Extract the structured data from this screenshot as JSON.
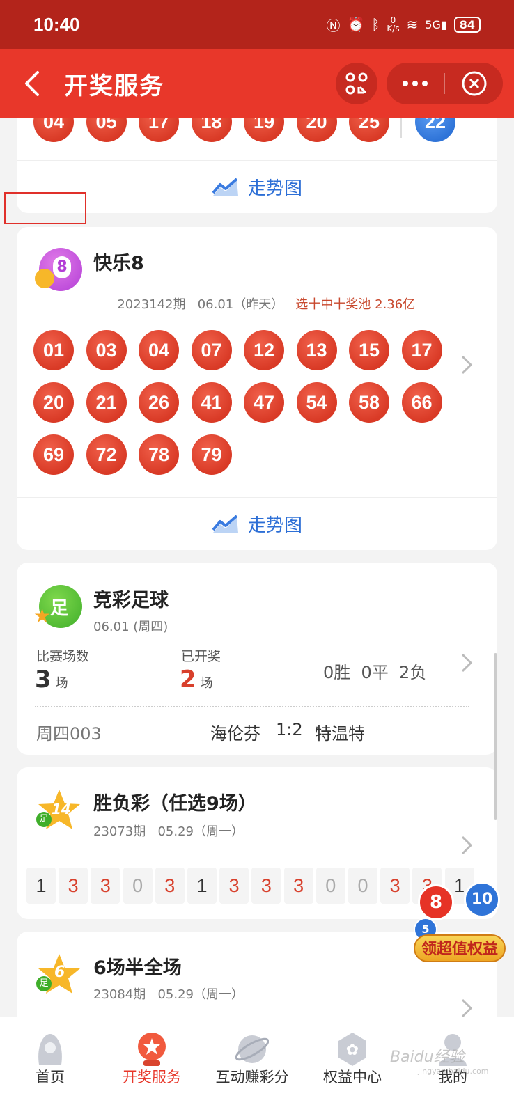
{
  "status_bar": {
    "time": "10:40",
    "net_speed": "0\nK/s",
    "battery": "84"
  },
  "header": {
    "title": "开奖服务"
  },
  "previous_card": {
    "balls": [
      "04",
      "05",
      "17",
      "18",
      "19",
      "20",
      "25"
    ],
    "blue_ball": "22",
    "trend_label": "走势图"
  },
  "kl8": {
    "name": "快乐8",
    "icon_text": "8",
    "issue": "2023142期",
    "date": "06.01（昨天）",
    "pool": "选十中十奖池 2.36亿",
    "balls": [
      "01",
      "03",
      "04",
      "07",
      "12",
      "13",
      "15",
      "17",
      "20",
      "21",
      "26",
      "41",
      "47",
      "54",
      "58",
      "66",
      "69",
      "72",
      "78",
      "79"
    ],
    "trend_label": "走势图"
  },
  "football": {
    "name": "竞彩足球",
    "icon_text": "足",
    "date": "06.01 (周四)",
    "matches_label": "比赛场数",
    "matches_value": "3",
    "matches_unit": "场",
    "drawn_label": "已开奖",
    "drawn_value": "2",
    "drawn_unit": "场",
    "summary": "0胜  0平  2负",
    "match": {
      "id": "周四003",
      "home": "海伦芬",
      "score": "1:2",
      "away": "特温特"
    }
  },
  "sfc": {
    "name": "胜负彩（任选9场）",
    "icon_text": "14",
    "icon_sub": "足",
    "issue": "23073期",
    "date": "05.29（周一）",
    "results": [
      "1",
      "3",
      "3",
      "0",
      "3",
      "1",
      "3",
      "3",
      "3",
      "0",
      "0",
      "3",
      "3",
      "1"
    ]
  },
  "half": {
    "name": "6场半全场",
    "icon_text": "6",
    "icon_sub": "足",
    "issue": "23084期",
    "date": "05.29（周一）"
  },
  "promo": {
    "label": "领超值权益",
    "ball_a": "8",
    "ball_b": "10",
    "ball_c": "5"
  },
  "nav": [
    {
      "label": "首页",
      "active": false
    },
    {
      "label": "开奖服务",
      "active": true
    },
    {
      "label": "互动赚彩分",
      "active": false
    },
    {
      "label": "权益中心",
      "active": false
    },
    {
      "label": "我的",
      "active": false
    }
  ],
  "watermark": "Baidu经验",
  "watermark_sub": "jingyan.baidu.com",
  "colors": {
    "brand_red": "#e8372a",
    "ball_red": "#d93a26",
    "ball_blue": "#2f74d8",
    "link_blue": "#2d6fd6"
  }
}
